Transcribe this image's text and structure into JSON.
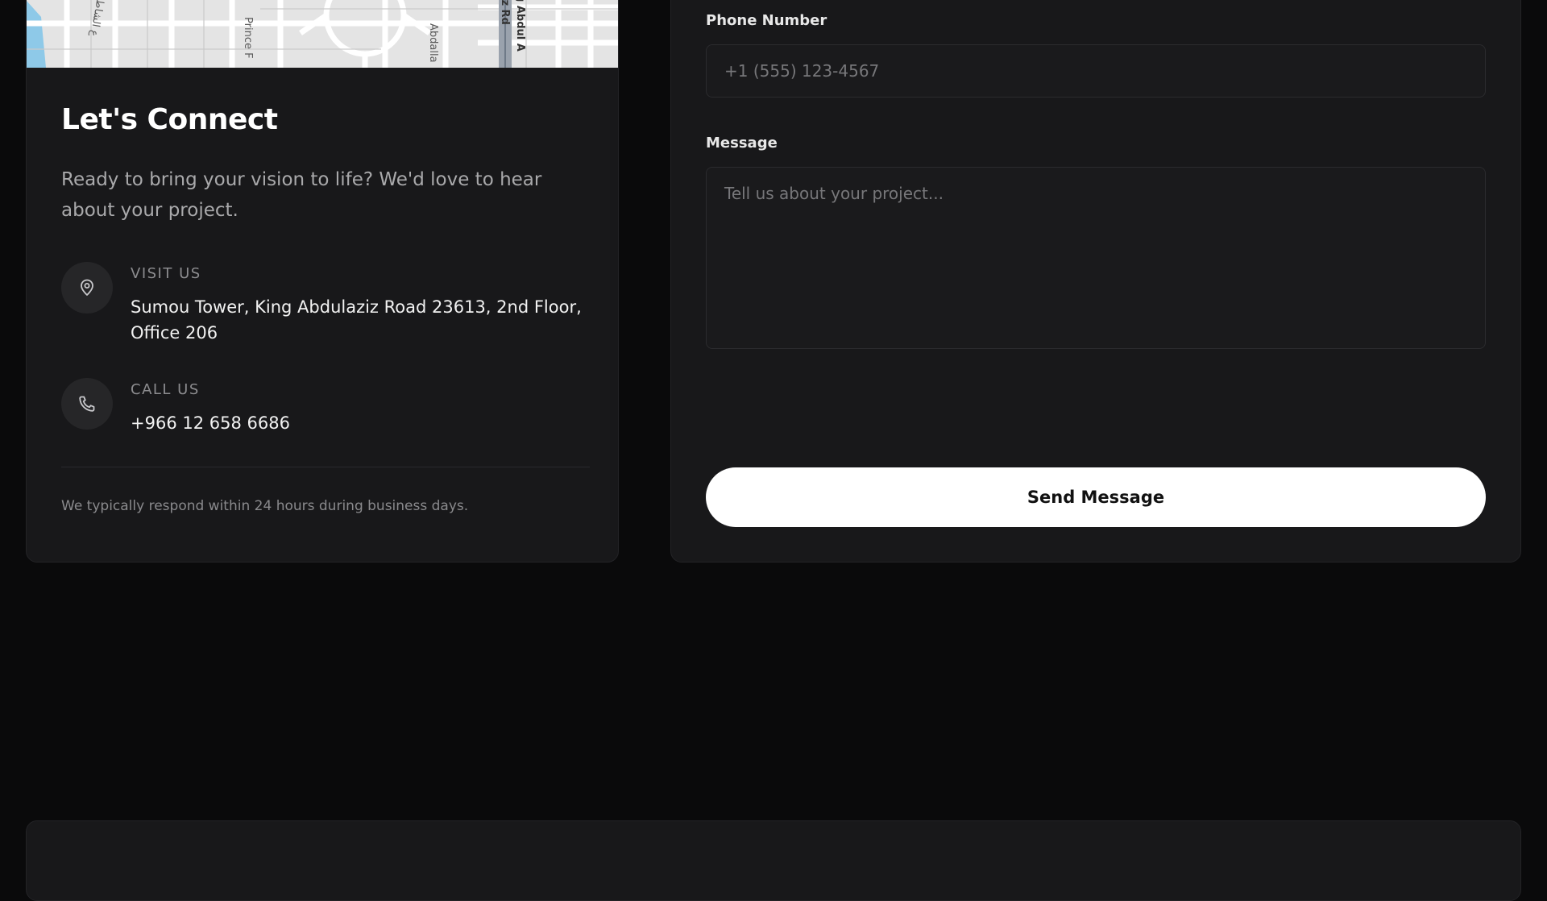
{
  "map": {
    "street_labels": [
      "Prince F",
      "Abdalla",
      "iz Rd",
      "g Abdul A",
      "ع الشاطئ"
    ],
    "colors": {
      "road": "#ffffff",
      "land": "#e4e4e4",
      "water": "#8ec9e8",
      "highway": "#9aa2ad"
    }
  },
  "contact": {
    "title": "Let's Connect",
    "intro": "Ready to bring your vision to life? We'd love to hear about your project.",
    "visit": {
      "icon": "location-pin-icon",
      "label": "VISIT US",
      "value": "Sumou Tower, King Abdulaziz Road 23613, 2nd Floor, Office 206"
    },
    "call": {
      "icon": "phone-icon",
      "label": "CALL US",
      "value": "+966 12 658 6686"
    },
    "note": "We typically respond within 24 hours during business days."
  },
  "form": {
    "phone_label": "Phone Number",
    "phone_placeholder": "+1 (555) 123-4567",
    "phone_value": "",
    "message_label": "Message",
    "message_placeholder": "Tell us about your project...",
    "message_value": "",
    "submit_label": "Send Message"
  },
  "theme": {
    "background": "#0a0a0b",
    "card": "#18181a",
    "accent_button": "#ffffff"
  }
}
